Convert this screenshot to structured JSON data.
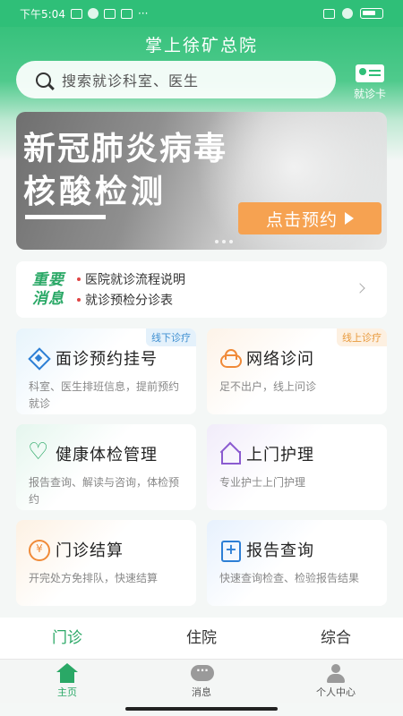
{
  "status_bar": {
    "time": "下午5:04",
    "more": "···"
  },
  "header": {
    "title": "掌上徐矿总院"
  },
  "search": {
    "placeholder": "搜索就诊科室、医生"
  },
  "card_button": {
    "label": "就诊卡"
  },
  "banner": {
    "line1": "新冠肺炎病毒",
    "line2": "核酸检测",
    "button": "点击预约"
  },
  "news": {
    "tag_line1": "重要",
    "tag_line2": "消息",
    "items": [
      "医院就诊流程说明",
      "就诊预检分诊表"
    ]
  },
  "services": [
    {
      "title": "面诊预约挂号",
      "desc": "科室、医生排班信息，提前预约就诊",
      "badge": "线下诊疗",
      "icon": "diamond-icon"
    },
    {
      "title": "网络诊问",
      "desc": "足不出户，线上问诊",
      "badge": "线上诊疗",
      "icon": "cloud-icon"
    },
    {
      "title": "健康体检管理",
      "desc": "报告查询、解读与咨询，体检预约",
      "icon": "heart-icon"
    },
    {
      "title": "上门护理",
      "desc": "专业护士上门护理",
      "icon": "house-icon"
    },
    {
      "title": "门诊结算",
      "desc": "开完处方免排队，快速结算",
      "icon": "yuan-coin-icon"
    },
    {
      "title": "报告查询",
      "desc": "快速查询检查、检验报告结果",
      "icon": "report-icon"
    }
  ],
  "category_tabs": [
    "门诊",
    "住院",
    "综合"
  ],
  "bottom_nav": [
    {
      "label": "主页",
      "icon": "home-icon"
    },
    {
      "label": "消息",
      "icon": "message-icon"
    },
    {
      "label": "个人中心",
      "icon": "user-icon"
    }
  ],
  "colors": {
    "primary": "#2fbf78",
    "accent_orange": "#f6a251",
    "tag_green": "#2aa866"
  }
}
